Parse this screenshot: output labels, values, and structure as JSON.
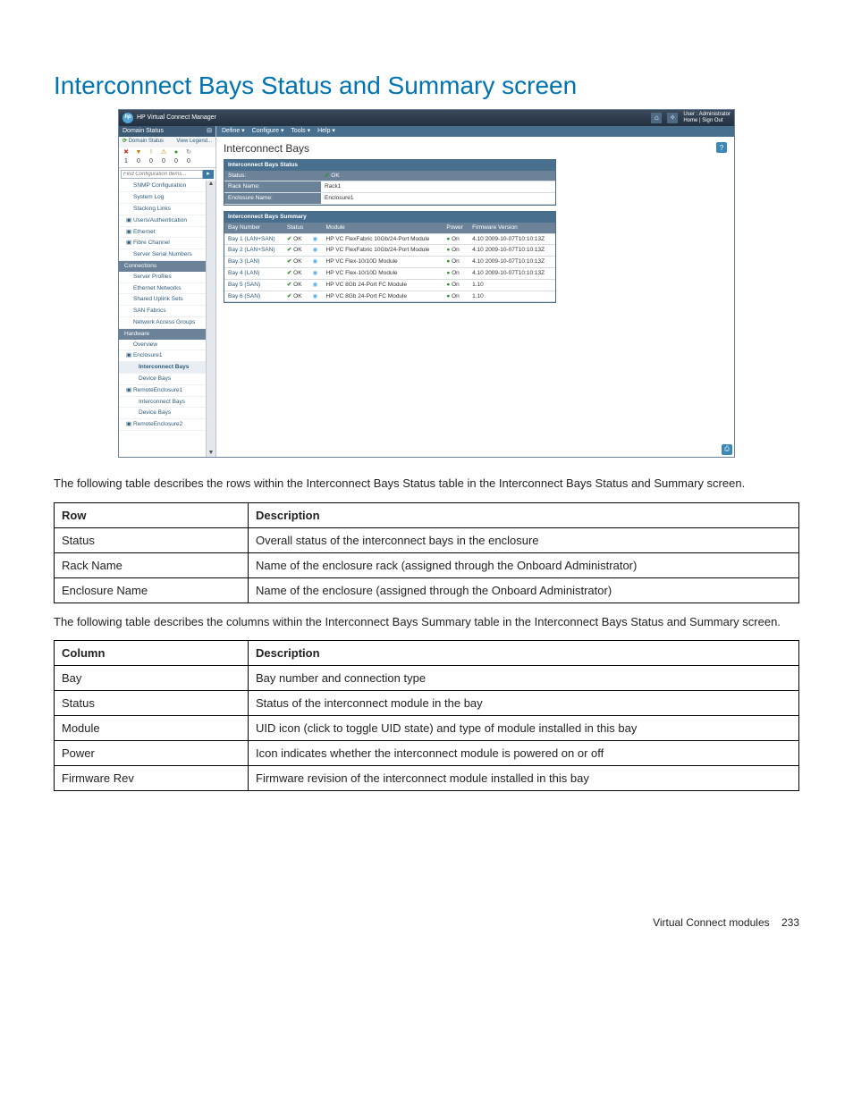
{
  "page": {
    "title": "Interconnect Bays Status and Summary screen",
    "para1": "The following table describes the rows within the Interconnect Bays Status table in the Interconnect Bays Status and Summary screen.",
    "para2": "The following table describes the columns within the Interconnect Bays Summary table in the Interconnect Bays Status and Summary screen.",
    "footer_section": "Virtual Connect modules",
    "footer_page": "233"
  },
  "app": {
    "brand": "HP Virtual Connect Manager",
    "user_line1": "User : Administrator",
    "user_line2": "Home  |  Sign Out",
    "menu": {
      "define": "Define ▾",
      "configure": "Configure ▾",
      "tools": "Tools ▾",
      "help": "Help ▾"
    },
    "sidebar": {
      "header": "Domain Status",
      "collapse": "⊟",
      "strip_left": "Domain Status",
      "strip_right": "View Legend...",
      "icons_row1": [
        "✖",
        "▼",
        "!",
        "⚠",
        "●",
        "↻"
      ],
      "icons_row2": [
        "1",
        "0",
        "0",
        "0",
        "0",
        "0"
      ],
      "search_placeholder": "Find Configuration Items...",
      "items_top": [
        "SNMP Configuration",
        "System Log",
        "Stacking Links"
      ],
      "items_mid": [
        "Users/Authentication",
        "Ethernet",
        "Fibre Channel",
        "Server Serial Numbers"
      ],
      "cat_connections": "Connections",
      "items_conn": [
        "Server Profiles",
        "Ethernet Networks",
        "Shared Uplink Sets",
        "SAN Fabrics",
        "Network Access Groups"
      ],
      "cat_hardware": "Hardware",
      "items_hw": [
        "Overview",
        "Enclosure1",
        "Interconnect Bays",
        "Device Bays",
        "RemoteEnclosure1",
        "Interconnect Bays",
        "Device Bays",
        "RemoteEnclosure2"
      ]
    },
    "content": {
      "title": "Interconnect Bays",
      "status_panel": {
        "header": "Interconnect Bays Status",
        "rows": [
          {
            "label": "Status:",
            "val_icon": "✔",
            "val_text": "OK"
          },
          {
            "label": "Rack Name:",
            "val_text": "Rack1"
          },
          {
            "label": "Enclosure Name:",
            "val_text": "Enclosure1"
          }
        ]
      },
      "summary_panel": {
        "header": "Interconnect Bays Summary",
        "cols": [
          "Bay Number",
          "Status",
          "",
          "Module",
          "Power",
          "Firmware Version"
        ],
        "rows": [
          {
            "bay": "Bay 1 (LAN+SAN)",
            "status": "OK",
            "module": "HP VC FlexFabric 10Gb/24-Port Module",
            "power": "On",
            "fw": "4.10 2009-10-07T10:10:13Z"
          },
          {
            "bay": "Bay 2 (LAN+SAN)",
            "status": "OK",
            "module": "HP VC FlexFabric 10Gb/24-Port Module",
            "power": "On",
            "fw": "4.10 2009-10-07T10:10:13Z"
          },
          {
            "bay": "Bay 3 (LAN)",
            "status": "OK",
            "module": "HP VC Flex-10/10D Module",
            "power": "On",
            "fw": "4.10 2009-10-07T10:10:13Z"
          },
          {
            "bay": "Bay 4 (LAN)",
            "status": "OK",
            "module": "HP VC Flex-10/10D Module",
            "power": "On",
            "fw": "4.10 2009-10-07T10:10:13Z"
          },
          {
            "bay": "Bay 5 (SAN)",
            "status": "OK",
            "module": "HP VC 8Gb 24-Port FC Module",
            "power": "On",
            "fw": "1.10"
          },
          {
            "bay": "Bay 6 (SAN)",
            "status": "OK",
            "module": "HP VC 8Gb 24-Port FC Module",
            "power": "On",
            "fw": "1.10"
          }
        ]
      }
    }
  },
  "table1": {
    "head": [
      "Row",
      "Description"
    ],
    "rows": [
      [
        "Status",
        "Overall status of the interconnect bays in the enclosure"
      ],
      [
        "Rack Name",
        "Name of the enclosure rack (assigned through the Onboard Administrator)"
      ],
      [
        "Enclosure Name",
        "Name of the enclosure (assigned through the Onboard Administrator)"
      ]
    ]
  },
  "table2": {
    "head": [
      "Column",
      "Description"
    ],
    "rows": [
      [
        "Bay",
        "Bay number and connection type"
      ],
      [
        "Status",
        "Status of the interconnect module in the bay"
      ],
      [
        "Module",
        "UID icon (click to toggle UID state) and type of module installed in this bay"
      ],
      [
        "Power",
        "Icon indicates whether the interconnect module is powered on or off"
      ],
      [
        "Firmware Rev",
        "Firmware revision of the interconnect module installed in this bay"
      ]
    ]
  }
}
